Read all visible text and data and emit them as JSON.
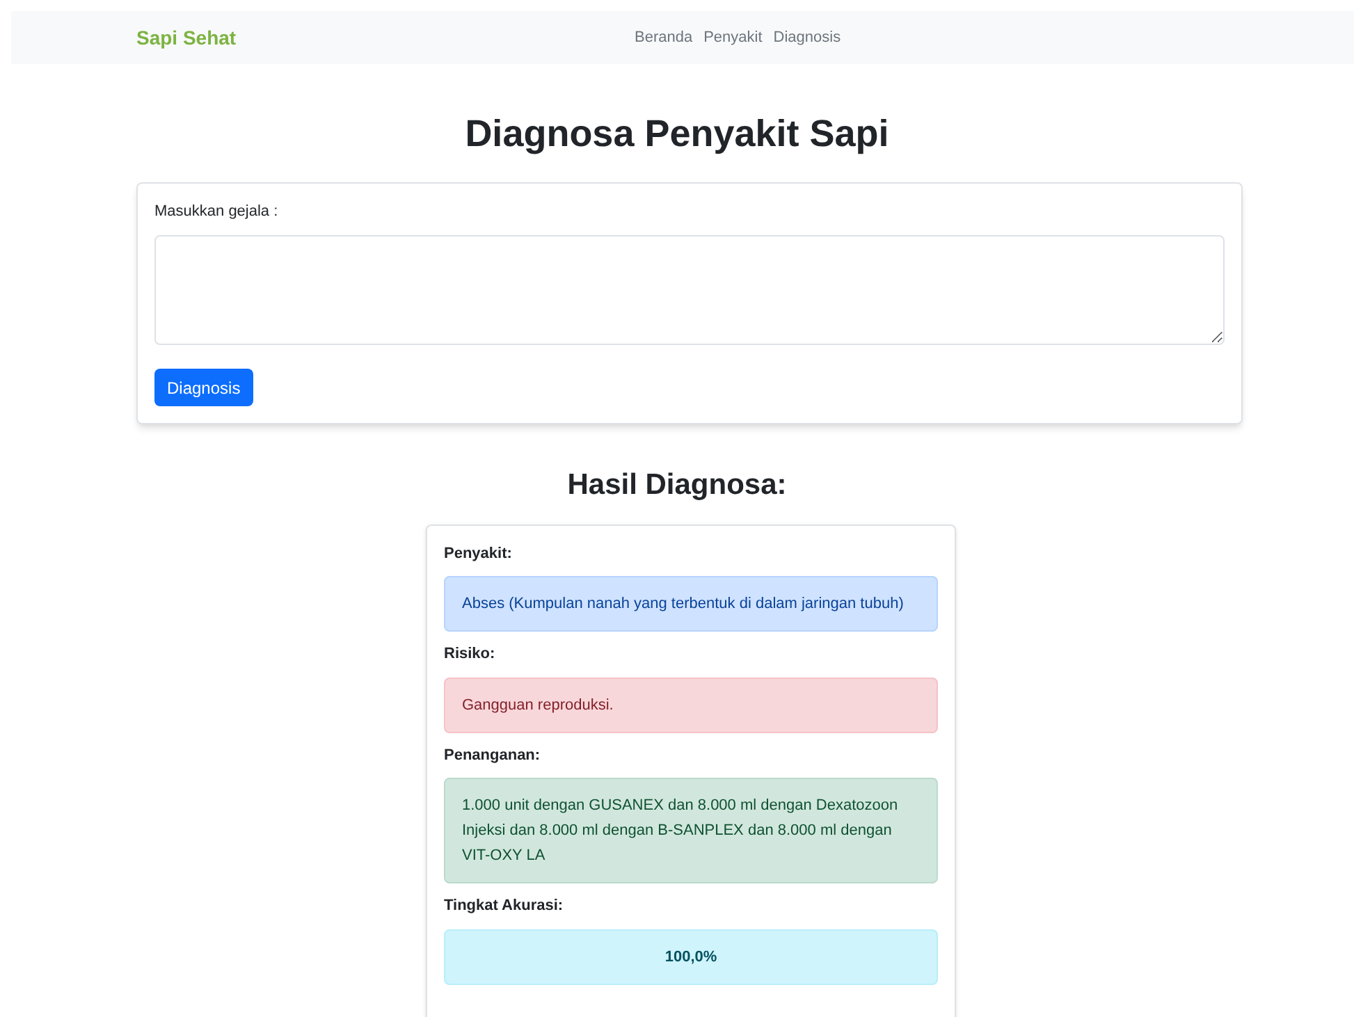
{
  "navbar": {
    "brand": "Sapi Sehat",
    "links": [
      {
        "label": "Beranda"
      },
      {
        "label": "Penyakit"
      },
      {
        "label": "Diagnosis"
      }
    ]
  },
  "title": "Diagnosa Penyakit Sapi",
  "form": {
    "label": "Masukkan gejala :",
    "button": "Diagnosis"
  },
  "results": {
    "heading": "Hasil Diagnosa:",
    "sections": [
      {
        "label": "Penyakit:",
        "kind": "info",
        "value": "Abses (Kumpulan nanah yang terbentuk di dalam jaringan tubuh)"
      },
      {
        "label": "Risiko:",
        "kind": "danger",
        "value": "Gangguan reproduksi."
      },
      {
        "label": "Penanganan:",
        "kind": "success",
        "value": "1.000 unit dengan GUSANEX dan 8.000 ml dengan Dexatozoon Injeksi dan 8.000 ml dengan B-SANPLEX dan 8.000 ml dengan VIT-OXY LA"
      },
      {
        "label": "Tingkat Akurasi:",
        "kind": "accuracy",
        "value": "100,0%"
      }
    ]
  }
}
